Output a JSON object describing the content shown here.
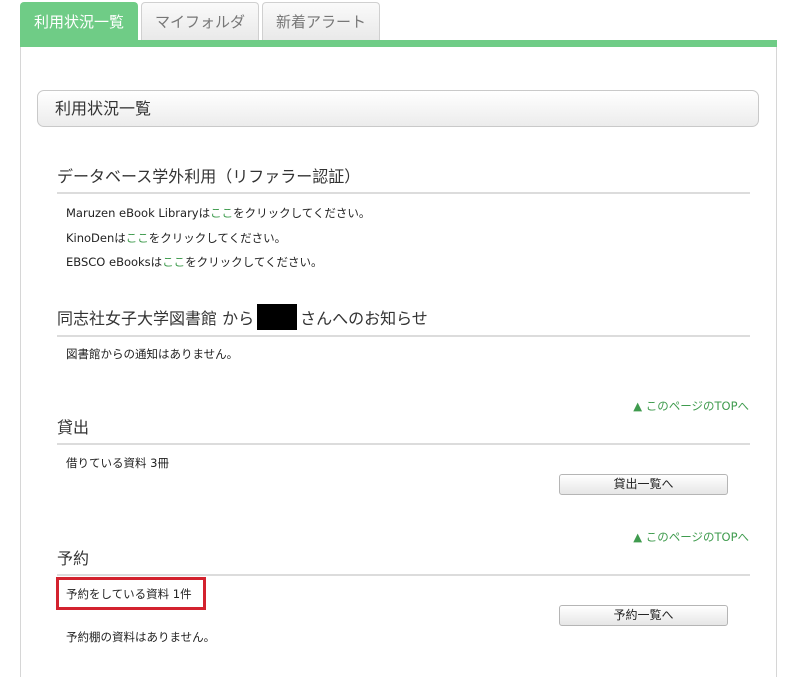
{
  "tabs": [
    {
      "label": "利用状況一覧",
      "active": true
    },
    {
      "label": "マイフォルダ",
      "active": false
    },
    {
      "label": "新着アラート",
      "active": false
    }
  ],
  "page_title": "利用状況一覧",
  "db_section": {
    "heading": "データベース学外利用（リファラー認証）",
    "items": [
      {
        "prefix": "Maruzen eBook Libraryは",
        "link": "ここ",
        "suffix": "をクリックしてください。"
      },
      {
        "prefix": "KinoDenは",
        "link": "ここ",
        "suffix": "をクリックしてください。"
      },
      {
        "prefix": "EBSCO eBooksは",
        "link": "ここ",
        "suffix": "をクリックしてください。"
      }
    ]
  },
  "notice_section": {
    "heading_prefix": "同志社女子大学図書館 から",
    "heading_suffix": "さんへのお知らせ",
    "message": "図書館からの通知はありません。"
  },
  "to_top_label": "▲ このページのTOPへ",
  "loan_section": {
    "heading": "貸出",
    "summary": "借りている資料 3冊",
    "button": "貸出一覧へ"
  },
  "reserve_section": {
    "heading": "予約",
    "summary": "予約をしている資料 1件",
    "button": "予約一覧へ",
    "shelf_message": "予約棚の資料はありません。"
  },
  "colors": {
    "accent": "#6fcc86",
    "link": "#3f9b4e",
    "highlight": "#d3222e"
  }
}
